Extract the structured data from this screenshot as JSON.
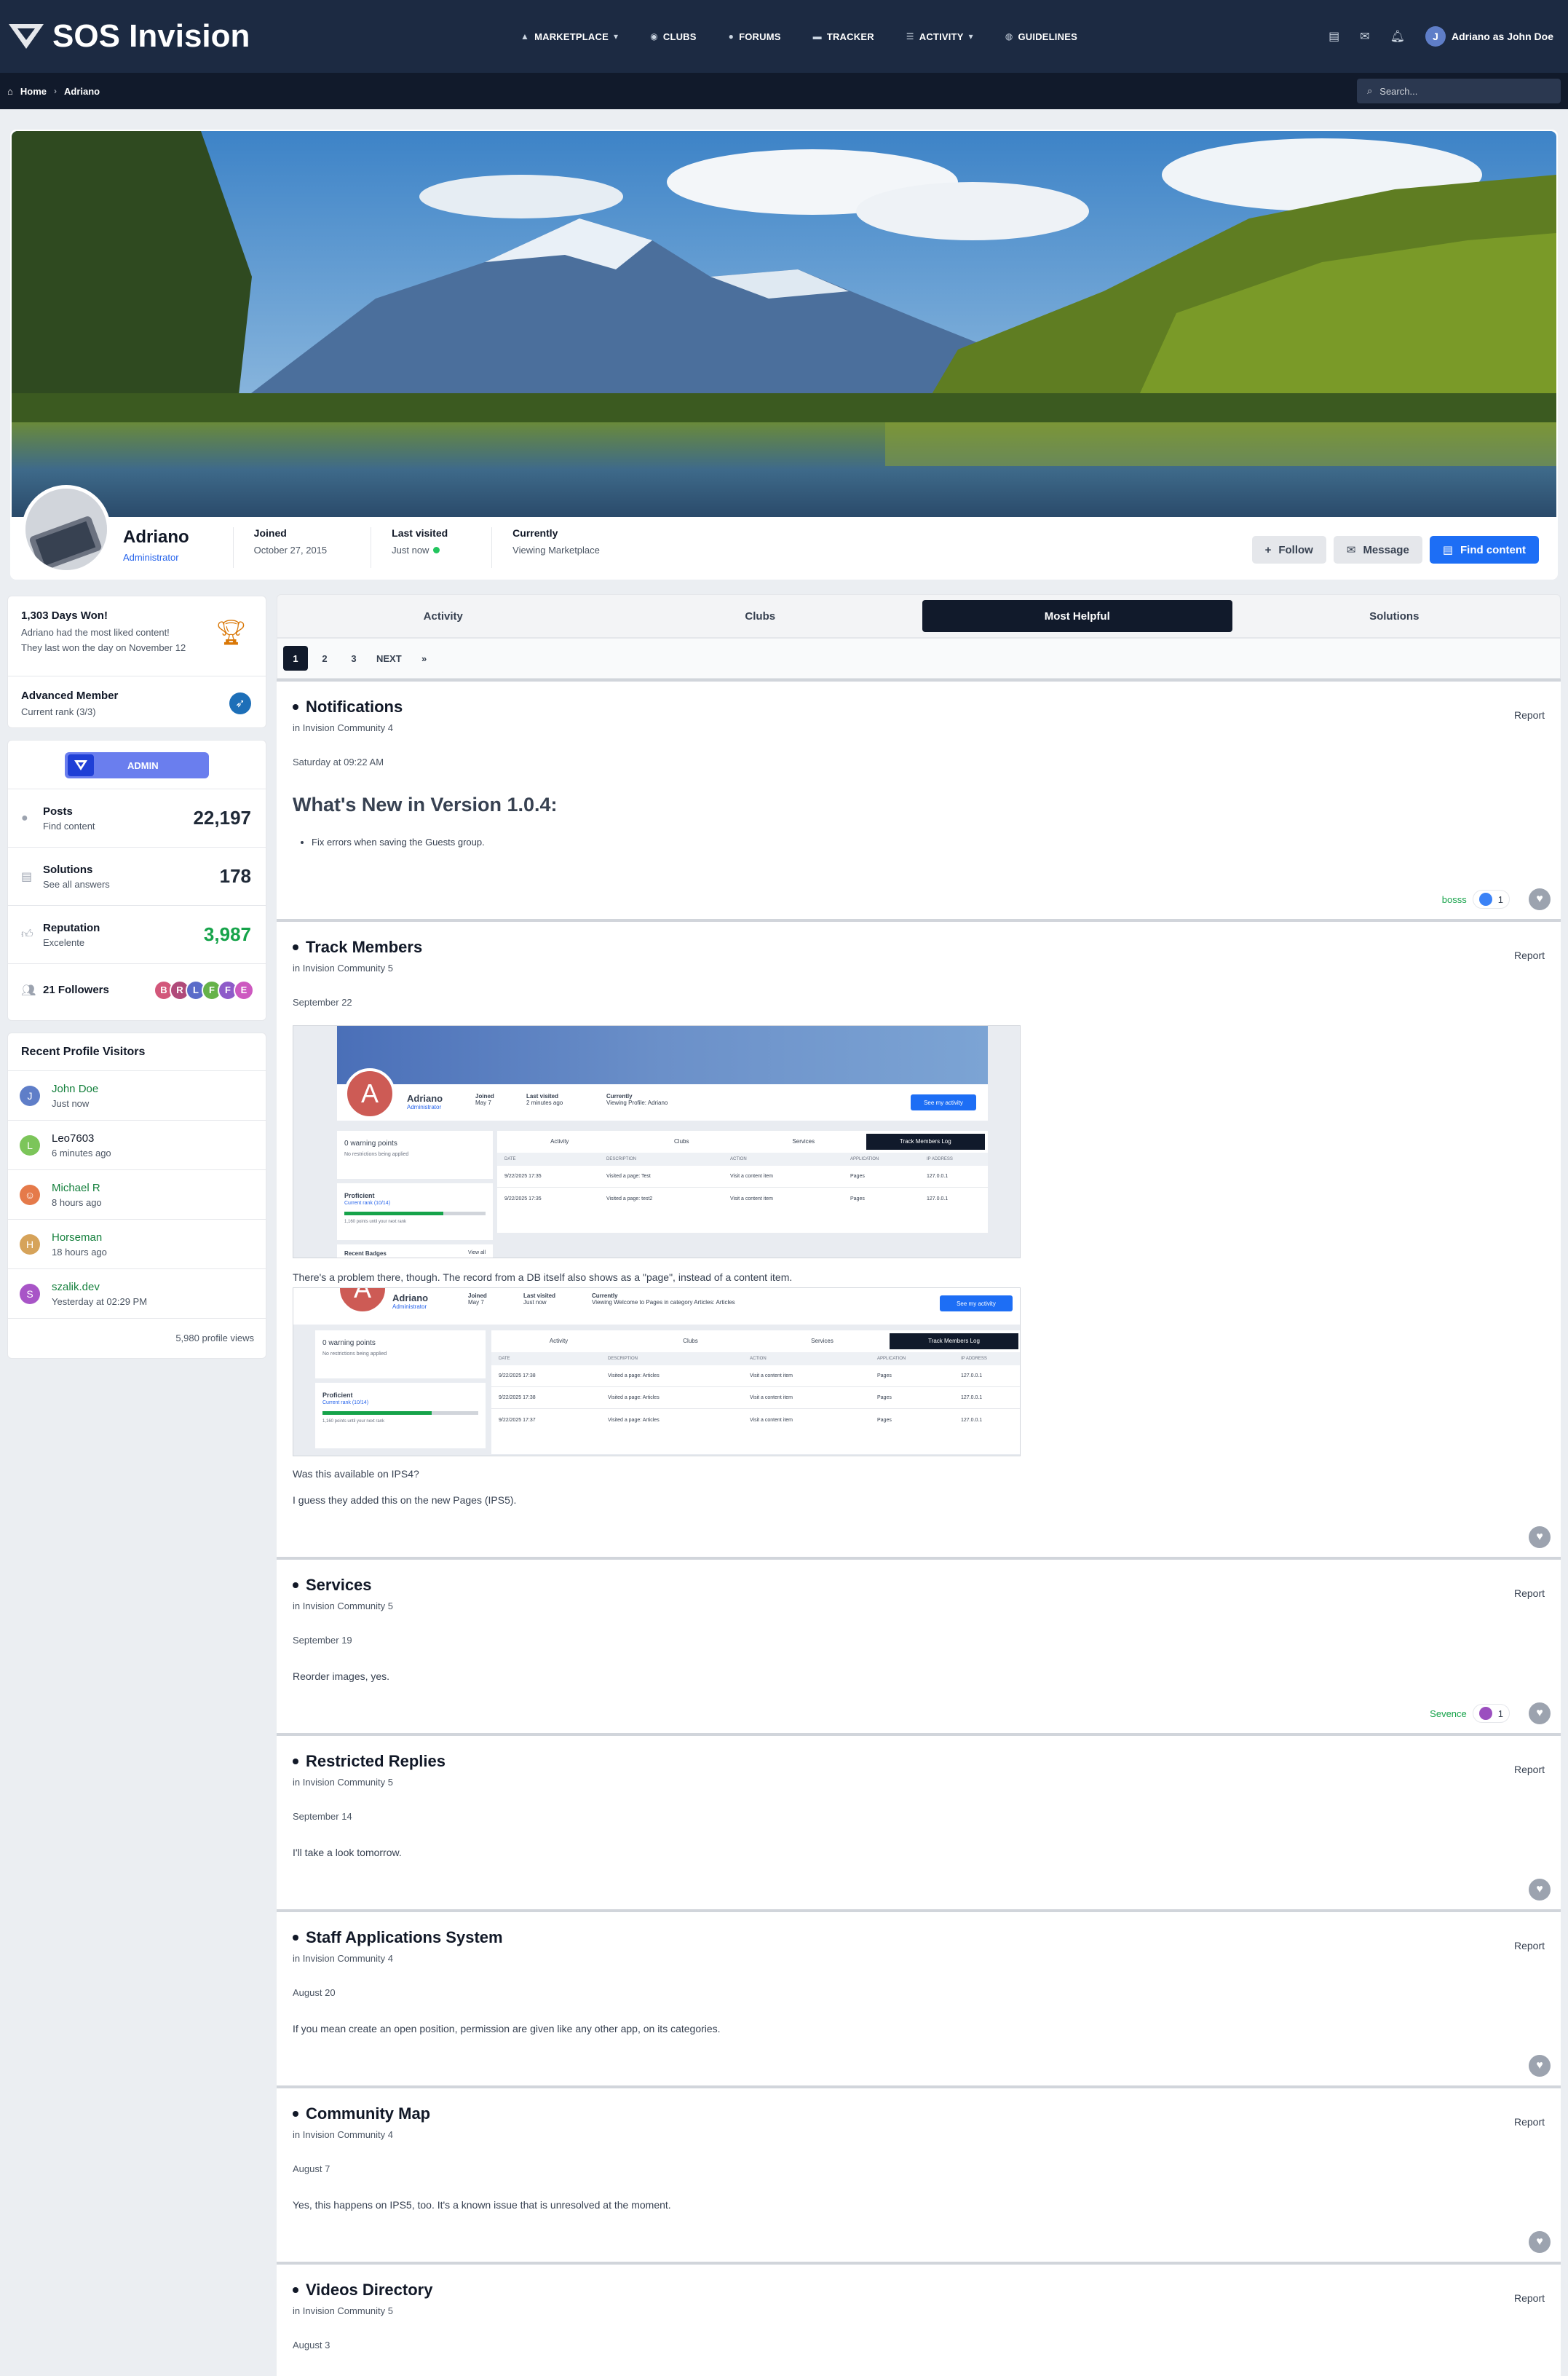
{
  "header": {
    "logo_text": "SOS Invision",
    "nav": [
      {
        "label": "MARKETPLACE",
        "icon": "marketplace-icon",
        "dropdown": true
      },
      {
        "label": "CLUBS",
        "icon": "clubs-icon",
        "dropdown": false
      },
      {
        "label": "FORUMS",
        "icon": "forums-icon",
        "dropdown": false
      },
      {
        "label": "TRACKER",
        "icon": "tracker-icon",
        "dropdown": false
      },
      {
        "label": "ACTIVITY",
        "icon": "activity-icon",
        "dropdown": true
      },
      {
        "label": "GUIDELINES",
        "icon": "guidelines-icon",
        "dropdown": false
      }
    ],
    "user_initial": "J",
    "user_name": "Adriano as John Doe"
  },
  "breadcrumb": {
    "home": "Home",
    "current": "Adriano"
  },
  "search": {
    "placeholder": "Search..."
  },
  "profile": {
    "name": "Adriano",
    "role": "Administrator",
    "stats": [
      {
        "label": "Joined",
        "value": "October 27, 2015"
      },
      {
        "label": "Last visited",
        "value": "Just now",
        "online": true
      },
      {
        "label": "Currently",
        "value": "Viewing Marketplace"
      }
    ],
    "buttons": {
      "follow": "Follow",
      "message": "Message",
      "find": "Find content"
    }
  },
  "sidebar": {
    "days_won": {
      "title": "1,303 Days Won!",
      "line1": "Adriano had the most liked content!",
      "line2": "They last won the day on November 12"
    },
    "rank": {
      "title": "Advanced Member",
      "sub": "Current rank (3/3)"
    },
    "badge": "ADMIN",
    "stats": [
      {
        "title": "Posts",
        "sub": "Find content",
        "value": "22,197",
        "icon": "posts-icon"
      },
      {
        "title": "Solutions",
        "sub": "See all answers",
        "value": "178",
        "icon": "solutions-icon"
      },
      {
        "title": "Reputation",
        "sub": "Excelente",
        "value": "3,987",
        "icon": "reputation-icon"
      }
    ],
    "followers": {
      "label": "21 Followers",
      "initials": [
        "B",
        "R",
        "L",
        "F",
        "F",
        "E"
      ]
    },
    "visitors_title": "Recent Profile Visitors",
    "visitors": [
      {
        "initial": "J",
        "name": "John Doe",
        "time": "Just now",
        "color": "#5f7ec8",
        "name_color": "#15803d"
      },
      {
        "initial": "L",
        "name": "Leo7603",
        "time": "6 minutes ago",
        "color": "#7cc55a",
        "name_color": "#111827"
      },
      {
        "initial": "",
        "name": "Michael R",
        "time": "8 hours ago",
        "color": "#e57a4a",
        "name_color": "#15803d"
      },
      {
        "initial": "H",
        "name": "Horseman",
        "time": "18 hours ago",
        "color": "#d6a35a",
        "name_color": "#15803d"
      },
      {
        "initial": "S",
        "name": "szalik.dev",
        "time": "Yesterday at 02:29 PM",
        "color": "#a855c7",
        "name_color": "#15803d"
      }
    ],
    "profile_views": "5,980 profile views"
  },
  "tabs": [
    "Activity",
    "Clubs",
    "Most Helpful",
    "Solutions"
  ],
  "pagination": [
    "1",
    "2",
    "3",
    "NEXT",
    "»"
  ],
  "report_label": "Report",
  "posts": [
    {
      "title": "Notifications",
      "in": "in Invision Community 4",
      "date": "Saturday at 09:22 AM",
      "heading": "What's New in Version 1.0.4:",
      "bullet": "Fix errors when saving the Guests group.",
      "reaction_user": "bosss",
      "reaction_count": "1"
    },
    {
      "title": "Track Members",
      "in": "in Invision Community 5",
      "date": "September 22",
      "text1": "There's a problem there, though. The record from a DB itself also shows as a \"page\", instead of a content item.",
      "text2": "Was this available on IPS4?",
      "text3": "I guess they added this on the new Pages (IPS5)."
    },
    {
      "title": "Services",
      "in": "in Invision Community 5",
      "date": "September 19",
      "body": "Reorder images, yes.",
      "reaction_user": "Sevence",
      "reaction_count": "1"
    },
    {
      "title": "Restricted Replies",
      "in": "in Invision Community 5",
      "date": "September 14",
      "body": "I'll take a look tomorrow."
    },
    {
      "title": "Staff Applications System",
      "in": "in Invision Community 4",
      "date": "August 20",
      "body": "If you mean create an open position, permission are given like any other app, on its categories."
    },
    {
      "title": "Community Map",
      "in": "in Invision Community 4",
      "date": "August 7",
      "body": "Yes, this happens on IPS5, too. It's a known issue that is unresolved at the moment."
    },
    {
      "title": "Videos Directory",
      "in": "in Invision Community 5",
      "date": "August 3"
    }
  ],
  "shot1": {
    "name": "Adriano",
    "role": "Administrator",
    "joined_l": "Joined",
    "joined_v": "May 7",
    "lv_l": "Last visited",
    "lv_v": "2 minutes ago",
    "cur_l": "Currently",
    "cur_v": "Viewing Profile: Adriano",
    "btn": "See my activity",
    "warn": "0 warning points",
    "warn_sub": "No restrictions being applied",
    "rank": "Proficient",
    "rank_sub": "Current rank (10/14)",
    "rank_pts": "1,160 points until your next rank",
    "badges": "Recent Badges",
    "view_all": "View all",
    "tabs": [
      "Activity",
      "Clubs",
      "Services",
      "Track Members Log"
    ],
    "cols": [
      "DATE",
      "DESCRIPTION",
      "ACTION",
      "APPLICATION",
      "IP ADDRESS"
    ],
    "rows": [
      [
        "9/22/2025 17:35",
        "Visited a page: Test",
        "Visit a content item",
        "Pages",
        "127.0.0.1"
      ],
      [
        "9/22/2025 17:35",
        "Visited a page: test2",
        "Visit a content item",
        "Pages",
        "127.0.0.1"
      ]
    ]
  },
  "shot2": {
    "name": "Adriano",
    "role": "Administrator",
    "joined_l": "Joined",
    "joined_v": "May 7",
    "lv_l": "Last visited",
    "lv_v": "Just now",
    "cur_l": "Currently",
    "cur_v": "Viewing Welcome to Pages in category Articles: Articles",
    "btn": "See my activity",
    "warn": "0 warning points",
    "warn_sub": "No restrictions being applied",
    "rank": "Proficient",
    "rank_sub": "Current rank (10/14)",
    "rank_pts": "1,160 points until your next rank",
    "tabs": [
      "Activity",
      "Clubs",
      "Services",
      "Track Members Log"
    ],
    "cols": [
      "DATE",
      "DESCRIPTION",
      "ACTION",
      "APPLICATION",
      "IP ADDRESS"
    ],
    "rows": [
      [
        "9/22/2025 17:38",
        "Visited a page: Articles",
        "Visit a content item",
        "Pages",
        "127.0.0.1"
      ],
      [
        "9/22/2025 17:38",
        "Visited a page: Articles",
        "Visit a content item",
        "Pages",
        "127.0.0.1"
      ],
      [
        "9/22/2025 17:37",
        "Visited a page: Articles",
        "Visit a content item",
        "Pages",
        "127.0.0.1"
      ]
    ]
  }
}
